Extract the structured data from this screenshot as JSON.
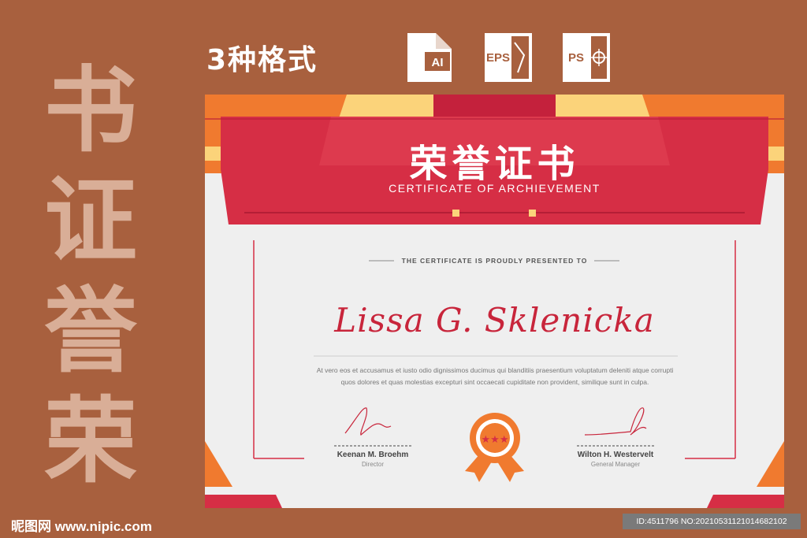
{
  "side_title": [
    "书",
    "证",
    "誉",
    "荣"
  ],
  "formats_label": "3种格式",
  "format_icons": [
    {
      "label": "AI",
      "icon": "ai-file-icon"
    },
    {
      "label": "EPS",
      "icon": "eps-file-icon"
    },
    {
      "label": "PS",
      "icon": "ps-file-icon"
    }
  ],
  "certificate": {
    "title": "荣誉证书",
    "subtitle": "CERTIFICATE OF ARCHIEVEMENT",
    "presented_text": "THE CERTIFICATE IS PROUDLY PRESENTED TO",
    "recipient": "Lissa G. Sklenicka",
    "body_line1": "At vero eos et accusamus et iusto odio dignissimos ducimus qui blanditiis praesentium voluptatum deleniti atque corrupti",
    "body_line2": "quos dolores et quas molestias excepturi sint occaecati cupiditate non provident, similique sunt in culpa.",
    "signers": [
      {
        "name": "Keenan M. Broehm",
        "role": "Director"
      },
      {
        "name": "Wilton H. Westervelt",
        "role": "General Manager"
      }
    ],
    "colors": {
      "red": "#D62E45",
      "orange": "#F07A2F",
      "yellow": "#FBD37A",
      "accent_dark": "#B91E3A"
    }
  },
  "watermark": "昵图网 www.nipic.com",
  "id_text": "ID:4511796 NO:20210531121014682102"
}
